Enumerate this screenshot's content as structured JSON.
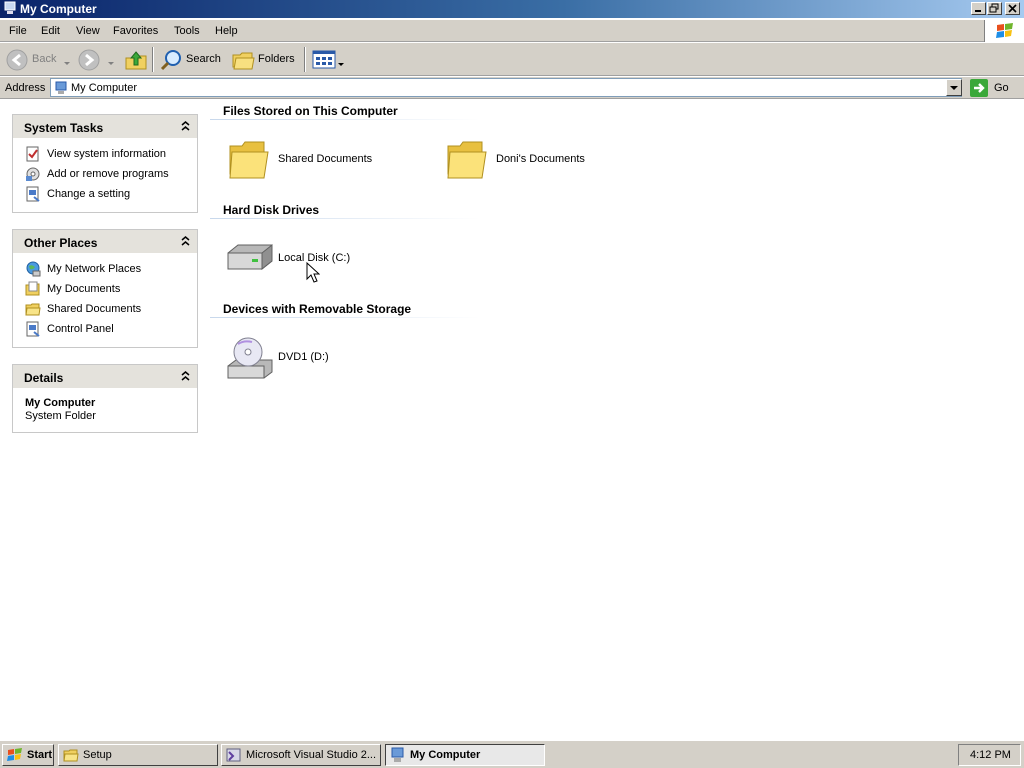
{
  "window": {
    "title": "My Computer"
  },
  "menubar": {
    "items": [
      "File",
      "Edit",
      "View",
      "Favorites",
      "Tools",
      "Help"
    ]
  },
  "toolbar": {
    "back": "Back",
    "search": "Search",
    "folders": "Folders"
  },
  "address": {
    "label": "Address",
    "value": "My Computer",
    "go": "Go"
  },
  "sidebar": {
    "system_tasks": {
      "title": "System Tasks",
      "links": [
        "View system information",
        "Add or remove programs",
        "Change a setting"
      ]
    },
    "other_places": {
      "title": "Other Places",
      "links": [
        "My Network Places",
        "My Documents",
        "Shared Documents",
        "Control Panel"
      ]
    },
    "details": {
      "title": "Details",
      "name": "My Computer",
      "type": "System Folder"
    }
  },
  "content": {
    "groups": [
      {
        "title": "Files Stored on This Computer",
        "items": [
          "Shared Documents",
          "Doni's Documents"
        ]
      },
      {
        "title": "Hard Disk Drives",
        "items": [
          "Local Disk (C:)"
        ]
      },
      {
        "title": "Devices with Removable Storage",
        "items": [
          "DVD1 (D:)"
        ]
      }
    ]
  },
  "taskbar": {
    "start": "Start",
    "buttons": [
      "Setup",
      "Microsoft Visual Studio 2...",
      "My Computer"
    ],
    "clock": "4:12 PM"
  }
}
